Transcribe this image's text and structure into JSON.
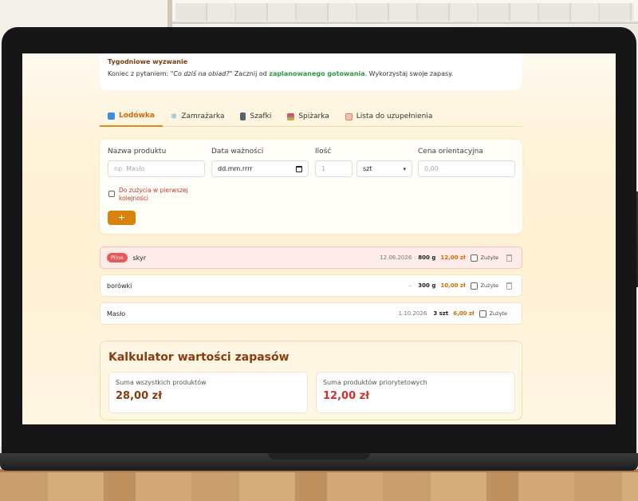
{
  "challenge": {
    "title": "Tygodniowe wyzwanie",
    "text_prefix": "Koniec z pytaniem: ",
    "text_quote": "\"Co dziś na obiad?\"",
    "text_mid": " Zacznij od ",
    "text_bold": "zaplanowanego gotowania",
    "text_suffix": ". Wykorzystaj swoje zapasy."
  },
  "tabs": [
    {
      "label": "Lodówka",
      "icon": "cube-icon",
      "color": "#3b8de0"
    },
    {
      "label": "Zamrażarka",
      "icon": "snowflake-icon",
      "color": "#5bb5e8"
    },
    {
      "label": "Szafki",
      "icon": "cabinet-icon",
      "color": "#556070"
    },
    {
      "label": "Spiżarka",
      "icon": "shelf-icon",
      "color": "#e05050"
    },
    {
      "label": "Lista do uzupełnienia",
      "icon": "notepad-icon",
      "color": "#d9826a"
    }
  ],
  "form": {
    "name_label": "Nazwa produktu",
    "name_placeholder": "np. Masło",
    "date_label": "Data ważności",
    "date_value": "dd.mm.rrrr",
    "qty_label": "Ilość",
    "qty_placeholder": "1",
    "unit_value": "szt",
    "price_label": "Cena orientacyjna",
    "price_placeholder": "0,00",
    "priority_label": "Do zużycia w pierwszej kolejności",
    "add_label": "+"
  },
  "items": [
    {
      "badge": "Pilne",
      "name": "skyr",
      "date": "12.06.2026",
      "qty": "800 g",
      "price": "12,00 zł",
      "used_label": "Zużyte"
    },
    {
      "badge": "",
      "name": "borówki",
      "date": "–",
      "qty": "300 g",
      "price": "10,00 zł",
      "used_label": "Zużyte"
    },
    {
      "badge": "",
      "name": "Masło",
      "date": "1.10.2026",
      "qty": "3 szt",
      "price": "6,00 zł",
      "used_label": "Zużyte"
    }
  ],
  "calculator": {
    "title": "Kalkulator wartości zapasów",
    "total_label": "Suma wszystkich produktów",
    "total_value": "28,00 zł",
    "priority_label": "Suma produktów priorytetowych",
    "priority_value": "12,00 zł"
  },
  "colors": {
    "accent": "#d9820e",
    "danger": "#d32f2f",
    "success": "#2e9a3a"
  }
}
